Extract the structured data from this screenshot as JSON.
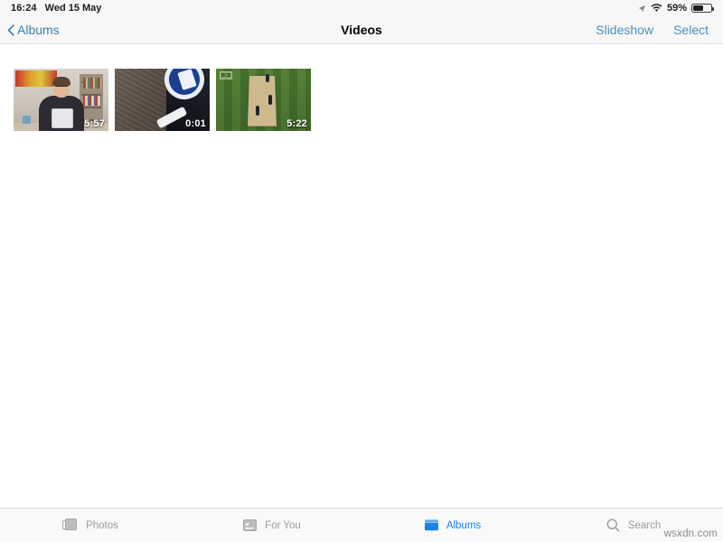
{
  "status_bar": {
    "time": "16:24",
    "date": "Wed 15 May",
    "location_icon": "location-arrow-icon",
    "wifi_icon": "wifi-icon",
    "battery_percent": "59%",
    "battery_level": 59,
    "battery_icon": "battery-icon"
  },
  "nav_bar": {
    "back_icon": "chevron-left-icon",
    "back_label": "Albums",
    "title": "Videos",
    "slideshow_label": "Slideshow",
    "select_label": "Select"
  },
  "videos": [
    {
      "duration": "5:57",
      "name": "video-thumbnail-person-desk"
    },
    {
      "duration": "0:01",
      "name": "video-thumbnail-road-sign"
    },
    {
      "duration": "5:22",
      "name": "video-thumbnail-cricket"
    }
  ],
  "thumb3_logo": "BCB",
  "tab_bar": {
    "tabs": [
      {
        "label": "Photos",
        "icon": "photos-stack-icon",
        "active": false
      },
      {
        "label": "For You",
        "icon": "for-you-card-icon",
        "active": false
      },
      {
        "label": "Albums",
        "icon": "albums-folder-icon",
        "active": true
      },
      {
        "label": "Search",
        "icon": "search-magnifier-icon",
        "active": false
      }
    ],
    "active_color": "#1b82e8",
    "inactive_color": "#9b9b9b"
  },
  "watermark": "wsxdn.com"
}
